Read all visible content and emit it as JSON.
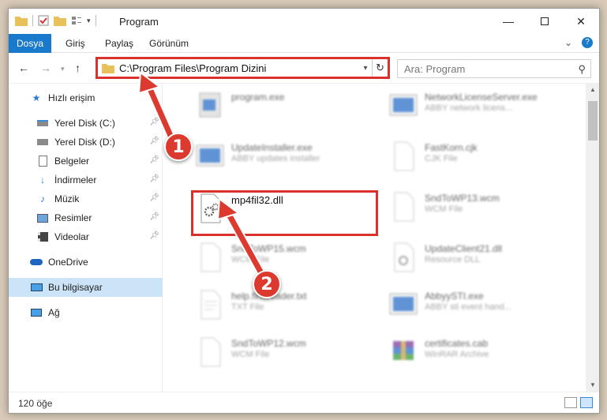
{
  "window": {
    "title": "Program"
  },
  "ribbon": {
    "tabs": [
      "Dosya",
      "Giriş",
      "Paylaş",
      "Görünüm"
    ]
  },
  "address": {
    "path": "C:\\Program Files\\Program Dizini"
  },
  "search": {
    "placeholder": "Ara: Program"
  },
  "sidebar": {
    "items": [
      {
        "label": "Hızlı erişim"
      },
      {
        "label": "Yerel Disk (C:)"
      },
      {
        "label": "Yerel Disk (D:)"
      },
      {
        "label": "Belgeler"
      },
      {
        "label": "İndirmeler"
      },
      {
        "label": "Müzik"
      },
      {
        "label": "Resimler"
      },
      {
        "label": "Videolar"
      },
      {
        "label": "OneDrive"
      },
      {
        "label": "Bu bilgisayar"
      },
      {
        "label": "Ağ"
      }
    ]
  },
  "files": [
    {
      "name": "program.exe",
      "desc": ""
    },
    {
      "name": "NetworkLicenseServer.exe",
      "desc": "ABBY network licens..."
    },
    {
      "name": "UpdateInstaller.exe",
      "desc": "ABBY updates installer"
    },
    {
      "name": "FastKorn.cjk",
      "desc": "CJK File"
    },
    {
      "name": "mp4fil32.dll",
      "desc": ""
    },
    {
      "name": "SndToWP13.wcm",
      "desc": "WCM File"
    },
    {
      "name": "SndToWP15.wcm",
      "desc": "WCM File"
    },
    {
      "name": "UpdateClient21.dll",
      "desc": "Resource DLL"
    },
    {
      "name": "help.finereader.txt",
      "desc": "TXT File"
    },
    {
      "name": "AbbyySTI.exe",
      "desc": "ABBY sti event hand..."
    },
    {
      "name": "SndToWP12.wcm",
      "desc": "WCM File"
    },
    {
      "name": "certificates.cab",
      "desc": "WinRAR Archive"
    }
  ],
  "status": {
    "count": "120 öğe"
  },
  "annotations": {
    "step1": "1",
    "step2": "2"
  },
  "colors": {
    "accent": "#1979ca",
    "highlight": "#d9312b"
  }
}
